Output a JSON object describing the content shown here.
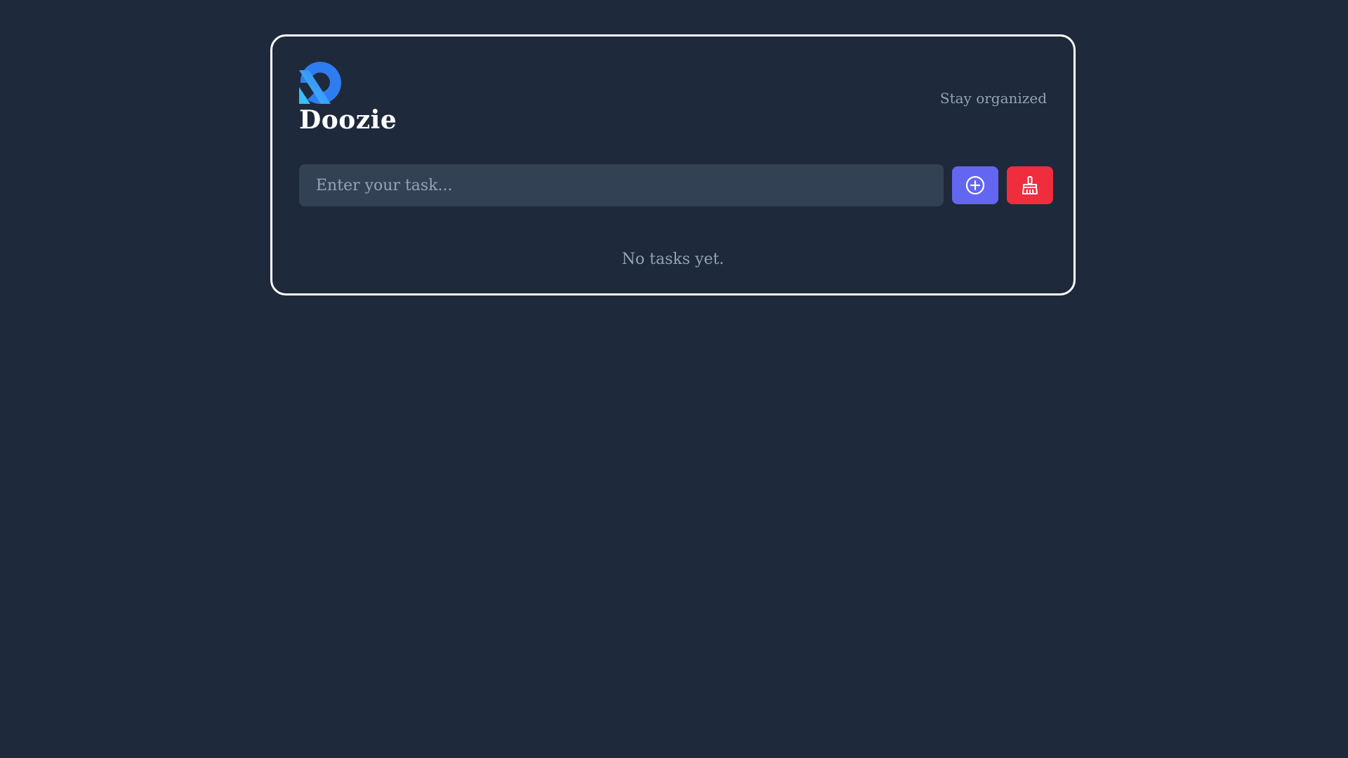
{
  "app": {
    "title": "Doozie",
    "tagline": "Stay organized",
    "logo_icon": "doozie-logo-icon"
  },
  "task_form": {
    "input_value": "",
    "input_placeholder": "Enter your task...",
    "add_button_icon": "plus-circle-icon",
    "clear_button_icon": "broom-icon"
  },
  "task_list": {
    "items": [],
    "empty_message": "No tasks yet."
  },
  "colors": {
    "background": "#1e293b",
    "card_border": "#ffffff",
    "input_background": "#334155",
    "add_button": "#6366f1",
    "clear_button": "#ef2d3c",
    "logo_gradient_start": "#3b82f6",
    "logo_gradient_end": "#38bdf8",
    "muted_text": "#94a3b8"
  }
}
